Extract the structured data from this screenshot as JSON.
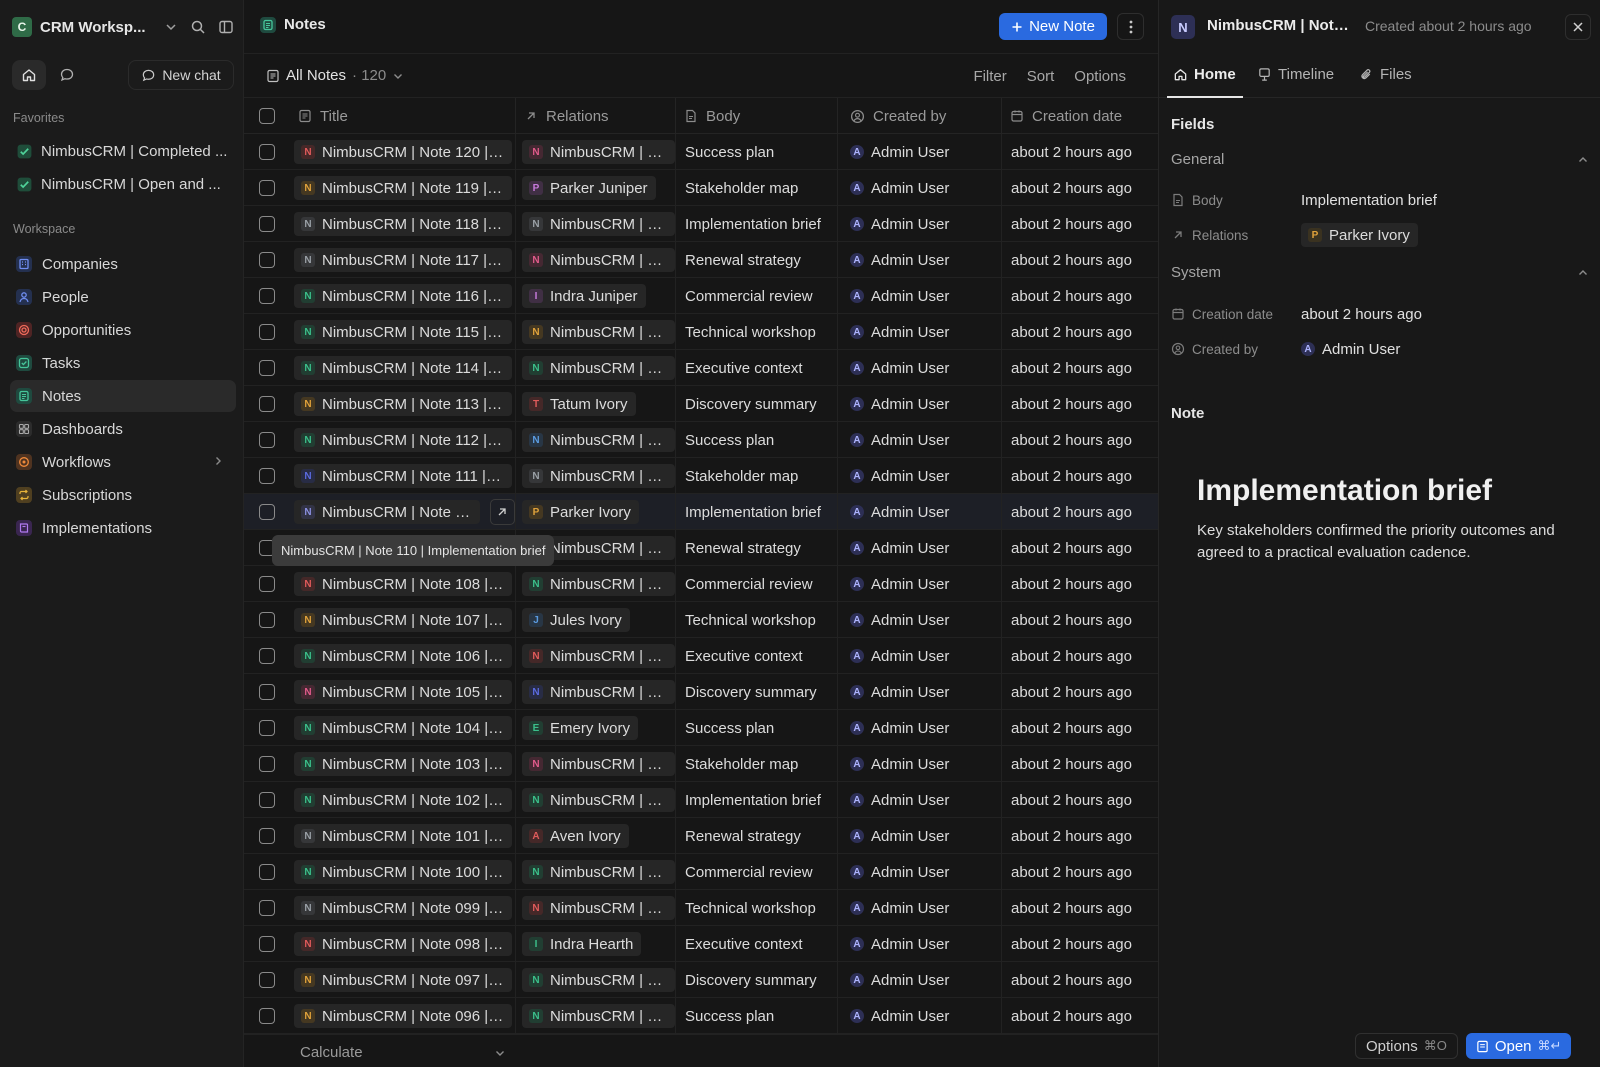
{
  "sidebar": {
    "workspace_name": "CRM Worksp...",
    "workspace_initial": "C",
    "new_chat_label": "New chat",
    "favorites_label": "Favorites",
    "favorites": [
      {
        "label": "NimbusCRM | Completed ..."
      },
      {
        "label": "NimbusCRM | Open and ..."
      }
    ],
    "workspace_label": "Workspace",
    "items": [
      {
        "label": "Companies",
        "icon": "building-icon",
        "color": "#4b6bd6"
      },
      {
        "label": "People",
        "icon": "person-icon",
        "color": "#4b6bd6"
      },
      {
        "label": "Opportunities",
        "icon": "target-icon",
        "color": "#d65a4b"
      },
      {
        "label": "Tasks",
        "icon": "checkbox-icon",
        "color": "#2f9a7a"
      },
      {
        "label": "Notes",
        "icon": "note-icon",
        "color": "#2f9a7a"
      },
      {
        "label": "Dashboards",
        "icon": "grid-icon",
        "color": "#8a8a8a"
      },
      {
        "label": "Workflows",
        "icon": "workflow-icon",
        "color": "#d67a2f"
      },
      {
        "label": "Subscriptions",
        "icon": "repeat-icon",
        "color": "#d6a22f"
      },
      {
        "label": "Implementations",
        "icon": "book-icon",
        "color": "#9b5bd6"
      }
    ]
  },
  "header": {
    "title": "Notes",
    "new_note_label": "New Note"
  },
  "view": {
    "name": "All Notes",
    "count": "· 120",
    "filter": "Filter",
    "sort": "Sort",
    "options": "Options"
  },
  "table": {
    "columns": {
      "title": "Title",
      "relations": "Relations",
      "body": "Body",
      "created_by": "Created by",
      "creation_date": "Creation date"
    },
    "rows": [
      {
        "title": "NimbusCRM | Note 120 | Su...",
        "initial": "N",
        "color": "#e05b5b",
        "rel": "NimbusCRM | Co...",
        "rel_initial": "N",
        "rel_color": "#e05b8a",
        "body": "Success plan",
        "by": "Admin User",
        "date": "about 2 hours ago"
      },
      {
        "title": "NimbusCRM | Note 119 | Sta...",
        "initial": "N",
        "color": "#e0a23b",
        "rel": "Parker Juniper",
        "rel_initial": "P",
        "rel_color": "#c77adb",
        "body": "Stakeholder map",
        "by": "Admin User",
        "date": "about 2 hours ago"
      },
      {
        "title": "NimbusCRM | Note 118 | Im...",
        "initial": "N",
        "color": "#9aa0a6",
        "rel": "NimbusCRM | Op...",
        "rel_initial": "N",
        "rel_color": "#9aa0a6",
        "body": "Implementation brief",
        "by": "Admin User",
        "date": "about 2 hours ago"
      },
      {
        "title": "NimbusCRM | Note 117 | Re...",
        "initial": "N",
        "color": "#9aa0a6",
        "rel": "NimbusCRM | Co...",
        "rel_initial": "N",
        "rel_color": "#e05b8a",
        "body": "Renewal strategy",
        "by": "Admin User",
        "date": "about 2 hours ago"
      },
      {
        "title": "NimbusCRM | Note 116 | Co...",
        "initial": "N",
        "color": "#3bbf8a",
        "rel": "Indra Juniper",
        "rel_initial": "I",
        "rel_color": "#c77adb",
        "body": "Commercial review",
        "by": "Admin User",
        "date": "about 2 hours ago"
      },
      {
        "title": "NimbusCRM | Note 115 | Te...",
        "initial": "N",
        "color": "#3bbf8a",
        "rel": "NimbusCRM | Op...",
        "rel_initial": "N",
        "rel_color": "#e0a23b",
        "body": "Technical workshop",
        "by": "Admin User",
        "date": "about 2 hours ago"
      },
      {
        "title": "NimbusCRM | Note 114 | Ex...",
        "initial": "N",
        "color": "#3bbf8a",
        "rel": "NimbusCRM | Co...",
        "rel_initial": "N",
        "rel_color": "#3bbf8a",
        "body": "Executive context",
        "by": "Admin User",
        "date": "about 2 hours ago"
      },
      {
        "title": "NimbusCRM | Note 113 | Dis...",
        "initial": "N",
        "color": "#e0a23b",
        "rel": "Tatum Ivory",
        "rel_initial": "T",
        "rel_color": "#e05b5b",
        "body": "Discovery summary",
        "by": "Admin User",
        "date": "about 2 hours ago"
      },
      {
        "title": "NimbusCRM | Note 112 | Su...",
        "initial": "N",
        "color": "#3bbf8a",
        "rel": "NimbusCRM | Op...",
        "rel_initial": "N",
        "rel_color": "#5b9be0",
        "body": "Success plan",
        "by": "Admin User",
        "date": "about 2 hours ago"
      },
      {
        "title": "NimbusCRM | Note 111 | Sta...",
        "initial": "N",
        "color": "#5b6be0",
        "rel": "NimbusCRM | Co...",
        "rel_initial": "N",
        "rel_color": "#9aa0a6",
        "body": "Stakeholder map",
        "by": "Admin User",
        "date": "about 2 hours ago"
      },
      {
        "title": "NimbusCRM | Note 110",
        "initial": "N",
        "color": "#8a8fe0",
        "rel": "Parker Ivory",
        "rel_initial": "P",
        "rel_color": "#e0a23b",
        "body": "Implementation brief",
        "by": "Admin User",
        "date": "about 2 hours ago"
      },
      {
        "title": "NimbusCRM | Note 109 | Re...",
        "initial": "N",
        "color": "#9aa0a6",
        "rel": "NimbusCRM | Op...",
        "rel_initial": "N",
        "rel_color": "#3bbf8a",
        "body": "Renewal strategy",
        "by": "Admin User",
        "date": "about 2 hours ago"
      },
      {
        "title": "NimbusCRM | Note 108 | Co...",
        "initial": "N",
        "color": "#e05b5b",
        "rel": "NimbusCRM | Co...",
        "rel_initial": "N",
        "rel_color": "#3bbf8a",
        "body": "Commercial review",
        "by": "Admin User",
        "date": "about 2 hours ago"
      },
      {
        "title": "NimbusCRM | Note 107 | Te...",
        "initial": "N",
        "color": "#e0a23b",
        "rel": "Jules Ivory",
        "rel_initial": "J",
        "rel_color": "#5b9be0",
        "body": "Technical workshop",
        "by": "Admin User",
        "date": "about 2 hours ago"
      },
      {
        "title": "NimbusCRM | Note 106 | Ex...",
        "initial": "N",
        "color": "#3bbf8a",
        "rel": "NimbusCRM | Op...",
        "rel_initial": "N",
        "rel_color": "#e05b5b",
        "body": "Executive context",
        "by": "Admin User",
        "date": "about 2 hours ago"
      },
      {
        "title": "NimbusCRM | Note 105 | Di...",
        "initial": "N",
        "color": "#e05b8a",
        "rel": "NimbusCRM | Co...",
        "rel_initial": "N",
        "rel_color": "#5b6be0",
        "body": "Discovery summary",
        "by": "Admin User",
        "date": "about 2 hours ago"
      },
      {
        "title": "NimbusCRM | Note 104 | Su...",
        "initial": "N",
        "color": "#3bbf8a",
        "rel": "Emery Ivory",
        "rel_initial": "E",
        "rel_color": "#3bbf8a",
        "body": "Success plan",
        "by": "Admin User",
        "date": "about 2 hours ago"
      },
      {
        "title": "NimbusCRM | Note 103 | St...",
        "initial": "N",
        "color": "#3bbf8a",
        "rel": "NimbusCRM | Op...",
        "rel_initial": "N",
        "rel_color": "#e05b8a",
        "body": "Stakeholder map",
        "by": "Admin User",
        "date": "about 2 hours ago"
      },
      {
        "title": "NimbusCRM | Note 102 | Im...",
        "initial": "N",
        "color": "#3bbf8a",
        "rel": "NimbusCRM | Co...",
        "rel_initial": "N",
        "rel_color": "#3bbf8a",
        "body": "Implementation brief",
        "by": "Admin User",
        "date": "about 2 hours ago"
      },
      {
        "title": "NimbusCRM | Note 101 | Re...",
        "initial": "N",
        "color": "#9aa0a6",
        "rel": "Aven Ivory",
        "rel_initial": "A",
        "rel_color": "#e05b5b",
        "body": "Renewal strategy",
        "by": "Admin User",
        "date": "about 2 hours ago"
      },
      {
        "title": "NimbusCRM | Note 100 | Co...",
        "initial": "N",
        "color": "#3bbf8a",
        "rel": "NimbusCRM | Op...",
        "rel_initial": "N",
        "rel_color": "#3bbf8a",
        "body": "Commercial review",
        "by": "Admin User",
        "date": "about 2 hours ago"
      },
      {
        "title": "NimbusCRM | Note 099 | Te...",
        "initial": "N",
        "color": "#9aa0a6",
        "rel": "NimbusCRM | Co...",
        "rel_initial": "N",
        "rel_color": "#e05b5b",
        "body": "Technical workshop",
        "by": "Admin User",
        "date": "about 2 hours ago"
      },
      {
        "title": "NimbusCRM | Note 098 | Ex...",
        "initial": "N",
        "color": "#e05b5b",
        "rel": "Indra Hearth",
        "rel_initial": "I",
        "rel_color": "#3bbf8a",
        "body": "Executive context",
        "by": "Admin User",
        "date": "about 2 hours ago"
      },
      {
        "title": "NimbusCRM | Note 097 | Di...",
        "initial": "N",
        "color": "#e0a23b",
        "rel": "NimbusCRM | Op...",
        "rel_initial": "N",
        "rel_color": "#3bbf8a",
        "body": "Discovery summary",
        "by": "Admin User",
        "date": "about 2 hours ago"
      },
      {
        "title": "NimbusCRM | Note 096 | Su...",
        "initial": "N",
        "color": "#e0a23b",
        "rel": "NimbusCRM | Co...",
        "rel_initial": "N",
        "rel_color": "#3bbf8a",
        "body": "Success plan",
        "by": "Admin User",
        "date": "about 2 hours ago"
      }
    ],
    "author_initial": "A",
    "tooltip": "NimbusCRM | Note 110 | Implementation brief",
    "calculate_label": "Calculate"
  },
  "panel": {
    "initial": "N",
    "title": "NimbusCRM | Note...",
    "created": "Created about 2 hours ago",
    "tabs": [
      {
        "label": "Home"
      },
      {
        "label": "Timeline"
      },
      {
        "label": "Files"
      }
    ],
    "fields_label": "Fields",
    "general_label": "General",
    "body_label": "Body",
    "body_value": "Implementation brief",
    "relations_label": "Relations",
    "relations_value": "Parker Ivory",
    "relations_initial": "P",
    "system_label": "System",
    "creation_date_label": "Creation date",
    "creation_date_value": "about 2 hours ago",
    "created_by_label": "Created by",
    "created_by_value": "Admin User",
    "created_by_initial": "A",
    "note_label": "Note",
    "note_heading": "Implementation brief",
    "note_text": "Key stakeholders confirmed the priority outcomes and agreed to a practical evaluation cadence.",
    "options_label": "Options",
    "options_kbd": "⌘O",
    "open_label": "Open",
    "open_kbd": "⌘↵"
  }
}
